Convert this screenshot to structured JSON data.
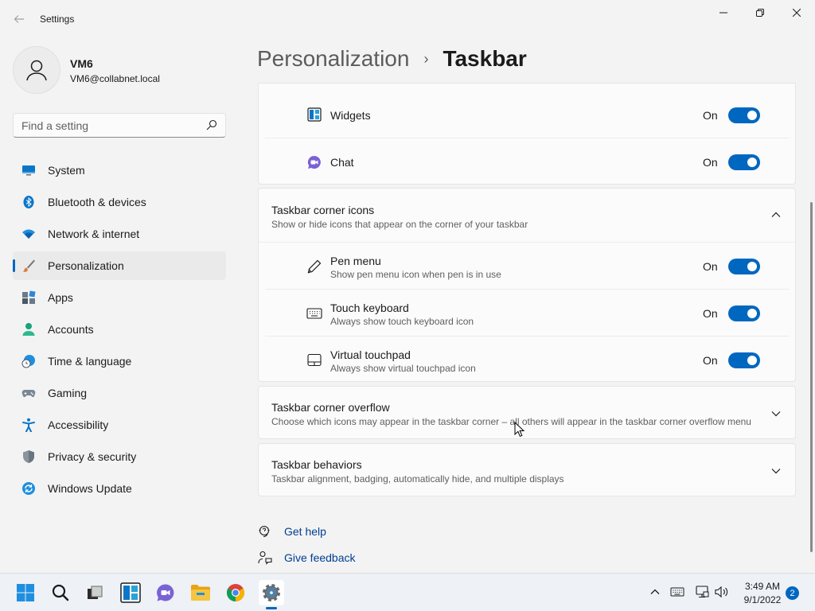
{
  "window": {
    "title": "Settings"
  },
  "profile": {
    "name": "VM6",
    "email": "VM6@collabnet.local"
  },
  "search": {
    "placeholder": "Find a setting"
  },
  "sidebar": {
    "items": [
      {
        "label": "System",
        "icon": "monitor-icon"
      },
      {
        "label": "Bluetooth & devices",
        "icon": "bluetooth-icon"
      },
      {
        "label": "Network & internet",
        "icon": "wifi-icon"
      },
      {
        "label": "Personalization",
        "icon": "brush-icon",
        "selected": true
      },
      {
        "label": "Apps",
        "icon": "apps-icon"
      },
      {
        "label": "Accounts",
        "icon": "person-icon"
      },
      {
        "label": "Time & language",
        "icon": "clock-globe-icon"
      },
      {
        "label": "Gaming",
        "icon": "gamepad-icon"
      },
      {
        "label": "Accessibility",
        "icon": "accessibility-icon"
      },
      {
        "label": "Privacy & security",
        "icon": "shield-icon"
      },
      {
        "label": "Windows Update",
        "icon": "update-icon"
      }
    ]
  },
  "header": {
    "parent": "Personalization",
    "separator": "›",
    "current": "Taskbar"
  },
  "taskbar_items": [
    {
      "title": "Widgets",
      "state": "On",
      "icon": "widgets-icon"
    },
    {
      "title": "Chat",
      "state": "On",
      "icon": "chat-icon"
    }
  ],
  "corner_icons": {
    "title": "Taskbar corner icons",
    "desc": "Show or hide icons that appear on the corner of your taskbar",
    "items": [
      {
        "title": "Pen menu",
        "desc": "Show pen menu icon when pen is in use",
        "state": "On",
        "icon": "pen-icon"
      },
      {
        "title": "Touch keyboard",
        "desc": "Always show touch keyboard icon",
        "state": "On",
        "icon": "keyboard-icon"
      },
      {
        "title": "Virtual touchpad",
        "desc": "Always show virtual touchpad icon",
        "state": "On",
        "icon": "touchpad-icon"
      }
    ]
  },
  "corner_overflow": {
    "title": "Taskbar corner overflow",
    "desc": "Choose which icons may appear in the taskbar corner – all others will appear in the taskbar corner overflow menu"
  },
  "behaviors": {
    "title": "Taskbar behaviors",
    "desc": "Taskbar alignment, badging, automatically hide, and multiple displays"
  },
  "links": {
    "help": "Get help",
    "feedback": "Give feedback"
  },
  "system_tray": {
    "time": "3:49 AM",
    "date": "9/1/2022",
    "notifications": "2"
  },
  "colors": {
    "accent": "#0067c0",
    "link": "#003e92"
  }
}
